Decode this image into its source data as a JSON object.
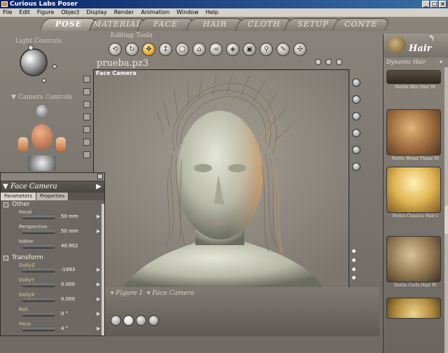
{
  "window": {
    "title": "Curious Labs Poser"
  },
  "menu": [
    "File",
    "Edit",
    "Figure",
    "Object",
    "Display",
    "Render",
    "Animation",
    "Window",
    "Help"
  ],
  "tabs": [
    "POSE",
    "MATERIAL",
    "FACE",
    "HAIR",
    "CLOTH",
    "SETUP",
    "CONTE"
  ],
  "light_controls": {
    "label": "Light Controls"
  },
  "camera_controls": {
    "label": "Camera Controls"
  },
  "editing_tools": {
    "label": "Editing Tools",
    "tool_icons": [
      "rotate-icon",
      "twist-icon",
      "translate-icon",
      "translate-in-out-icon",
      "scale-icon",
      "taper-icon",
      "chain-break-icon",
      "color-icon",
      "grouping-icon",
      "view-magnifier-icon",
      "morphing-icon",
      "direct-manipulation-icon"
    ],
    "selected_index": 2
  },
  "document": {
    "name": "prueba.pz3",
    "camera": "Face Camera"
  },
  "bottom_bar": {
    "figure": "Figure 1",
    "camera": "Face Camera"
  },
  "parameters_panel": {
    "title": "Face Camera",
    "tabs": [
      "Parameters",
      "Properties"
    ],
    "sections": [
      {
        "name": "Other",
        "params": [
          {
            "label": "Focal",
            "value": "50 mm"
          },
          {
            "label": "Perspective",
            "value": "50 mm"
          },
          {
            "label": "hither",
            "value": "40.902"
          }
        ]
      },
      {
        "name": "Transform",
        "params": [
          {
            "label": "DollyZ",
            "value": "-1993"
          },
          {
            "label": "DollyY",
            "value": "0.000"
          },
          {
            "label": "DollyX",
            "value": "0.000"
          },
          {
            "label": "Roll",
            "value": "0 °"
          },
          {
            "label": "Pitch",
            "value": "4 °"
          }
        ]
      }
    ]
  },
  "library": {
    "title": "Hair",
    "category": "Dynamic Hair",
    "items": [
      "Nettis Afro Hair M",
      "Nettis Blond Flame M",
      "Nettis Classics Hair I",
      "Nettis Curls Hair M",
      ""
    ]
  }
}
